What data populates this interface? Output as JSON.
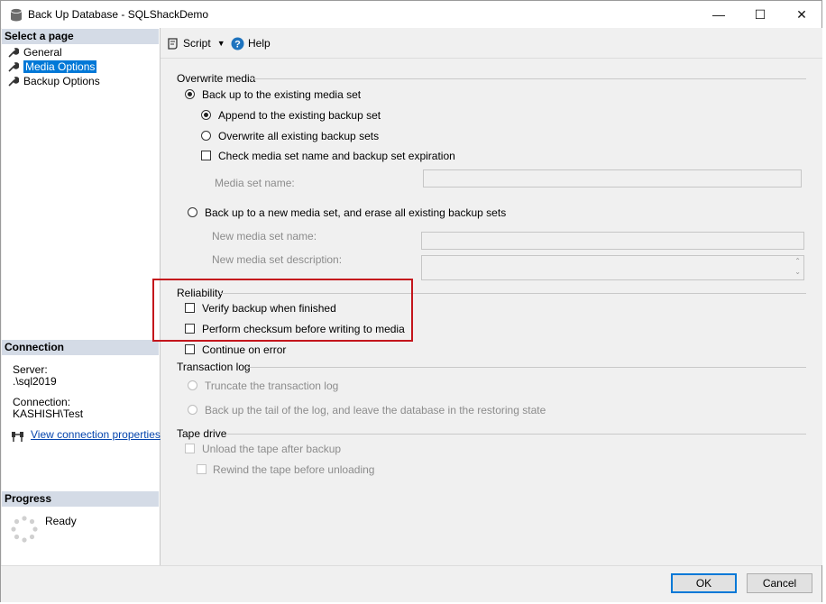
{
  "window": {
    "title": "Back Up Database - SQLShackDemo",
    "minimize_glyph": "—",
    "maximize_glyph": "☐",
    "close_glyph": "✕"
  },
  "left": {
    "select_page_header": "Select a page",
    "pages": [
      {
        "label": "General",
        "selected": false
      },
      {
        "label": "Media Options",
        "selected": true
      },
      {
        "label": "Backup Options",
        "selected": false
      }
    ],
    "connection_header": "Connection",
    "server_label": "Server:",
    "server_value": ".\\sql2019",
    "connection_label": "Connection:",
    "connection_value": "KASHISH\\Test",
    "view_connection_link": "View connection properties",
    "progress_header": "Progress",
    "progress_status": "Ready"
  },
  "toolbar": {
    "script_label": "Script",
    "help_label": "Help"
  },
  "overwrite": {
    "group_label": "Overwrite media",
    "existing_set_label": "Back up to the existing media set",
    "append_label": "Append to the existing backup set",
    "overwrite_all_label": "Overwrite all existing backup sets",
    "check_media_label": "Check media set name and backup set expiration",
    "media_set_name_label": "Media set name:",
    "new_set_label": "Back up to a new media set, and erase all existing backup sets",
    "new_media_name_label": "New media set name:",
    "new_media_desc_label": "New media set description:"
  },
  "reliability": {
    "group_label": "Reliability",
    "verify_label": "Verify backup when finished",
    "checksum_label": "Perform checksum before writing to media",
    "continue_label": "Continue on error"
  },
  "translog": {
    "group_label": "Transaction log",
    "truncate_label": "Truncate the transaction log",
    "tail_label": "Back up the tail of the log, and leave the database in the restoring state"
  },
  "tape": {
    "group_label": "Tape drive",
    "unload_label": "Unload the tape after backup",
    "rewind_label": "Rewind the tape before unloading"
  },
  "footer": {
    "ok_label": "OK",
    "cancel_label": "Cancel"
  },
  "colors": {
    "selection": "#0078d7",
    "highlight_box": "#c4161c",
    "section_header": "#d4dbe6"
  }
}
